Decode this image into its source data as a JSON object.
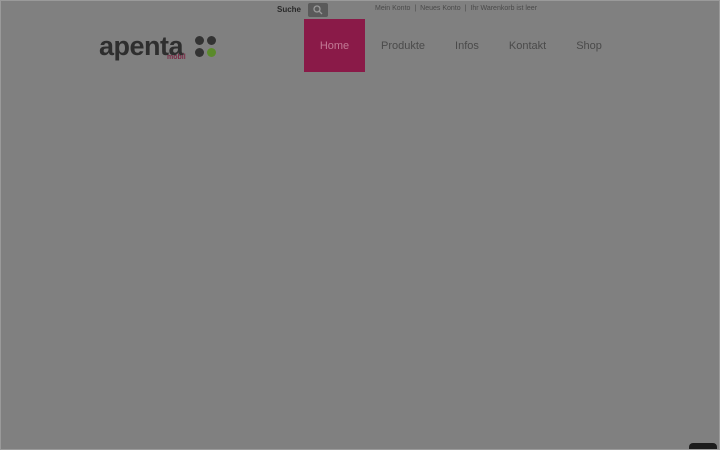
{
  "header": {
    "search_label": "Suche",
    "search_icon": "search-icon",
    "top_links": [
      "Mein Konto",
      "Neues Konto",
      "Ihr Warenkorb ist leer"
    ],
    "top_link_separator": "|"
  },
  "logo": {
    "wordmark": "apenta",
    "subline": "mobil",
    "dot_colors": [
      "#333333",
      "#333333",
      "#333333",
      "#5a8a2a"
    ]
  },
  "nav": {
    "items": [
      {
        "label": "Home",
        "active": true
      },
      {
        "label": "Produkte",
        "active": false
      },
      {
        "label": "Infos",
        "active": false
      },
      {
        "label": "Kontakt",
        "active": false
      },
      {
        "label": "Shop",
        "active": false
      }
    ],
    "active_color": "#8a1a48"
  }
}
